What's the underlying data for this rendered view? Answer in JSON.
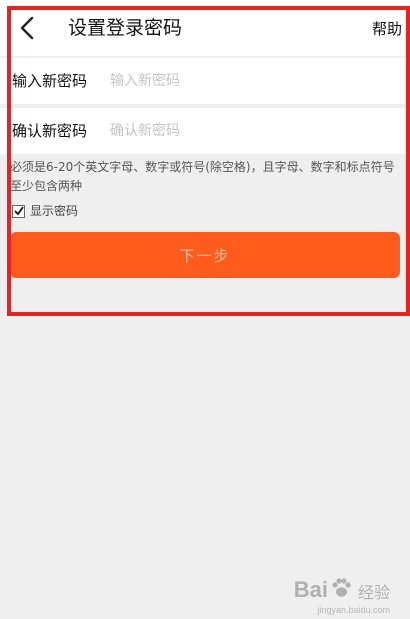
{
  "header": {
    "title": "设置登录密码",
    "help_label": "帮助"
  },
  "form": {
    "new_password": {
      "label": "输入新密码",
      "placeholder": "输入新密码"
    },
    "confirm_password": {
      "label": "确认新密码",
      "placeholder": "确认新密码"
    },
    "hint": "必须是6-20个英文字母、数字或符号(除空格)，且字母、数字和标点符号至少包含两种",
    "show_password": {
      "label": "显示密码",
      "checked": true
    },
    "next_button": "下一步"
  },
  "watermark": {
    "brand_prefix": "Bai",
    "brand_suffix": "经验",
    "url": "jingyan.baidu.com"
  },
  "colors": {
    "accent": "#ff5b1c",
    "frame": "#e52323",
    "background": "#efefef"
  },
  "icons": {
    "back": "chevron-left-icon",
    "checkbox": "checkmark-icon",
    "watermark": "paw-icon"
  }
}
